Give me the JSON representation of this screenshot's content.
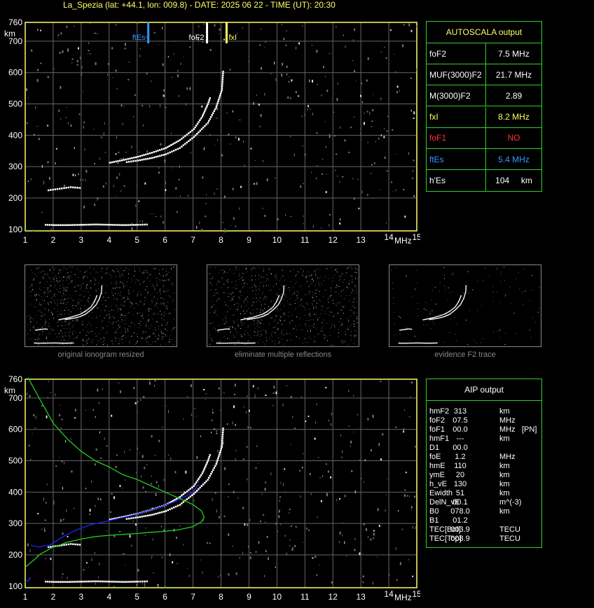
{
  "header": {
    "title": "La_Spezia (lat: +44.1, lon: 009.8) - DATE: 2025 06 22 - TIME (UT): 20:30"
  },
  "axes": {
    "ylabel": "km",
    "xlabel": "MHz",
    "yticks": [
      "100",
      "200",
      "300",
      "400",
      "500",
      "600",
      "700",
      "760"
    ],
    "xticks": [
      "1",
      "2",
      "3",
      "4",
      "5",
      "6",
      "7",
      "8",
      "9",
      "10",
      "11",
      "12",
      "13",
      "14",
      "15"
    ]
  },
  "top_markers": {
    "ftEs": "ftEs",
    "foF2": "foF2",
    "fxI": "fxI"
  },
  "colors": {
    "green": "#33cc33",
    "yellow": "#ffff66",
    "blue": "#3399ff",
    "red": "#ff3333",
    "trace_blue": "#2222ff",
    "model_green": "#22cc22"
  },
  "autoscala": {
    "title": "AUTOSCALA output",
    "rows": [
      {
        "label": "foF2",
        "value": "7.5 MHz",
        "color": "#ffffff"
      },
      {
        "label": "MUF(3000)F2",
        "value": "21.7 MHz",
        "color": "#ffffff"
      },
      {
        "label": "M(3000)F2",
        "value": "2.89",
        "color": "#ffffff"
      },
      {
        "label": "fxI",
        "value": "8.2 MHz",
        "color": "#ffff66"
      },
      {
        "label": "foF1",
        "value": "NO",
        "color": "#ff3333"
      },
      {
        "label": "ftEs",
        "value": "5.4 MHz",
        "color": "#3399ff"
      },
      {
        "label": "h'Es",
        "value": "104     km",
        "color": "#ffffff"
      }
    ]
  },
  "thumbnails": {
    "captions": [
      "original ionogram resized",
      "eliminate multiple reflections",
      "evidence F2 trace"
    ]
  },
  "aip": {
    "title": "AIP output",
    "rows": [
      {
        "label": "hmF2",
        "value": "313",
        "unit": "km",
        "extra": ""
      },
      {
        "label": "foF2",
        "value": "07.5",
        "unit": "MHz",
        "extra": ""
      },
      {
        "label": "foF1",
        "value": "00.0",
        "unit": "MHz",
        "extra": "[PN]"
      },
      {
        "label": "hmF1",
        "value": "---",
        "unit": "km",
        "extra": ""
      },
      {
        "label": "D1",
        "value": "00.0",
        "unit": "",
        "extra": ""
      },
      {
        "label": "foE",
        "value": "1.2",
        "unit": "MHz",
        "extra": ""
      },
      {
        "label": "hmE",
        "value": "110",
        "unit": "km",
        "extra": ""
      },
      {
        "label": "ymE",
        "value": "20",
        "unit": "km",
        "extra": ""
      },
      {
        "label": "h_vE",
        "value": "130",
        "unit": "km",
        "extra": ""
      },
      {
        "label": "Ewidth",
        "value": "51",
        "unit": "km",
        "extra": ""
      },
      {
        "label": "DelN_vE",
        "value": "00.1",
        "unit": "m^(-3)",
        "extra": ""
      },
      {
        "label": "B0",
        "value": "078.0",
        "unit": "km",
        "extra": ""
      },
      {
        "label": "B1",
        "value": "01.2",
        "unit": "",
        "extra": ""
      },
      {
        "label": "TEC[Bot]",
        "value": "003.9",
        "unit": "TECU",
        "extra": ""
      },
      {
        "label": "TEC[Top]",
        "value": "008.9",
        "unit": "TECU",
        "extra": ""
      }
    ]
  },
  "chart_data": [
    {
      "type": "scatter",
      "title": "",
      "xlabel": "MHz",
      "ylabel": "km",
      "xlim": [
        1,
        15
      ],
      "ylim": [
        95,
        760
      ],
      "grid": true,
      "markers": [
        {
          "name": "ftEs",
          "x": 5.4,
          "color": "#3399ff"
        },
        {
          "name": "foF2",
          "x": 7.5,
          "color": "#ffffff"
        },
        {
          "name": "fxI",
          "x": 8.2,
          "color": "#ffff66"
        }
      ],
      "series": [
        {
          "x": [
            4.0,
            4.5,
            5.0,
            5.5,
            6.0,
            6.5,
            7.0,
            7.3,
            7.5,
            7.6
          ],
          "y": [
            313,
            322,
            332,
            345,
            360,
            385,
            420,
            460,
            500,
            525
          ]
        },
        {
          "x": [
            4.6,
            5.0,
            5.5,
            6.0,
            6.5,
            7.0,
            7.5,
            7.8,
            8.0,
            8.05
          ],
          "y": [
            315,
            320,
            328,
            340,
            360,
            395,
            440,
            490,
            545,
            610
          ]
        },
        {
          "x": [
            1.7,
            2.0,
            2.5,
            3.0,
            3.5,
            4.0,
            4.5,
            5.0,
            5.4
          ],
          "y": [
            115,
            114,
            114,
            115,
            116,
            115,
            114,
            115,
            116
          ]
        },
        {
          "x": [
            1.8,
            2.2,
            2.6,
            3.0
          ],
          "y": [
            225,
            230,
            235,
            232
          ]
        }
      ]
    },
    {
      "type": "line",
      "title": "",
      "xlabel": "MHz",
      "ylabel": "km",
      "xlim": [
        1,
        15
      ],
      "ylim": [
        95,
        760
      ],
      "grid": true,
      "series": [
        {
          "x": [
            4.0,
            4.5,
            5.0,
            5.5,
            6.0,
            6.5,
            7.0,
            7.3,
            7.5,
            7.6
          ],
          "y": [
            313,
            322,
            332,
            345,
            360,
            385,
            420,
            460,
            500,
            525
          ]
        },
        {
          "x": [
            4.6,
            5.0,
            5.5,
            6.0,
            6.5,
            7.0,
            7.5,
            7.8,
            8.0,
            8.05
          ],
          "y": [
            315,
            320,
            328,
            340,
            360,
            395,
            440,
            490,
            545,
            610
          ]
        },
        {
          "x": [
            1.7,
            2.0,
            2.5,
            3.0,
            3.5,
            4.0,
            4.5,
            5.0,
            5.4
          ],
          "y": [
            115,
            114,
            114,
            115,
            116,
            115,
            114,
            115,
            116
          ]
        },
        {
          "x": [
            1.8,
            2.2,
            2.6,
            3.0
          ],
          "y": [
            225,
            230,
            235,
            232
          ]
        },
        {
          "x": [
            1.2,
            1.5,
            1.9,
            2.3,
            2.8,
            3.3,
            3.8,
            4.3,
            4.8,
            5.3,
            5.8,
            6.3,
            6.7,
            7.0,
            7.2
          ],
          "y": [
            230,
            225,
            232,
            255,
            278,
            295,
            305,
            315,
            325,
            338,
            352,
            368,
            385,
            400,
            425
          ],
          "color": "#2222ff"
        },
        {
          "x": [
            1.0,
            1.1,
            1.2,
            1.15,
            1.05
          ],
          "y": [
            112,
            118,
            128,
            122,
            115
          ],
          "color": "#2222ff"
        },
        {
          "x": [
            1.1,
            1.5,
            2.0,
            2.5,
            3.0,
            3.5,
            4.0,
            4.5,
            5.0,
            5.5,
            6.0,
            6.5,
            7.0,
            7.3,
            7.4,
            7.3,
            7.0,
            6.5,
            6.0,
            5.5,
            5.0,
            4.5,
            4.0,
            3.5,
            3.0,
            2.5,
            2.2,
            2.0,
            1.8,
            1.6,
            1.5
          ],
          "y": [
            765,
            700,
            620,
            570,
            530,
            500,
            480,
            455,
            440,
            420,
            400,
            380,
            360,
            340,
            320,
            305,
            290,
            280,
            275,
            272,
            268,
            265,
            262,
            258,
            250,
            240,
            230,
            225,
            215,
            205,
            200
          ],
          "color": "#22cc22"
        },
        {
          "x": [
            1.0,
            1.2,
            1.4,
            1.5
          ],
          "y": [
            160,
            175,
            190,
            200
          ],
          "color": "#22cc22"
        }
      ]
    }
  ]
}
